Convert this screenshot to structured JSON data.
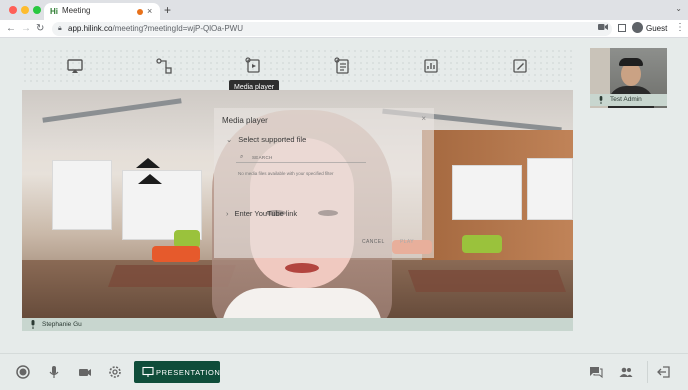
{
  "browser": {
    "tab_title": "Meeting",
    "favicon_text": "Hi",
    "tab_close": "×",
    "new_tab": "+",
    "url_host": "app.hilink.co",
    "url_path": "/meeting?meetingId=wjP-QlOa-PWU",
    "profile_label": "Guest",
    "icons": [
      "back-icon",
      "forward-icon",
      "reload-icon",
      "lock-icon",
      "camera-icon",
      "sidepanel-icon",
      "profile-icon",
      "kebab-menu-icon",
      "tab-search-icon"
    ]
  },
  "toolstrip": {
    "tools": [
      "screen-share-icon",
      "whiteboard-flow-icon",
      "media-player-icon",
      "document-icon",
      "analytics-icon",
      "edit-notes-icon"
    ],
    "tooltip": "Media player"
  },
  "main_video": {
    "participant_name": "Stephanie Gu"
  },
  "media_player_modal": {
    "title": "Media player",
    "close": "×",
    "section_file": "Select supported file",
    "search_placeholder": "SEARCH",
    "help_text": "No media files available with your specified filter",
    "section_youtube": "Enter YouTube link",
    "cancel_label": "CANCEL",
    "play_label": "PLAY",
    "chevron_open": "⌄",
    "chevron_closed": "›"
  },
  "self_view": {
    "participant_name": "Test Admin"
  },
  "bottom_bar": {
    "presentation_label": "PRESENTATION",
    "icons": [
      "record-icon",
      "microphone-icon",
      "camera-icon",
      "settings-icon",
      "chat-icon",
      "participants-icon",
      "leave-icon"
    ]
  },
  "colors": {
    "accent": "#0f4d3a",
    "label_bar": "#c8d6cf",
    "background": "#e6ebea"
  }
}
